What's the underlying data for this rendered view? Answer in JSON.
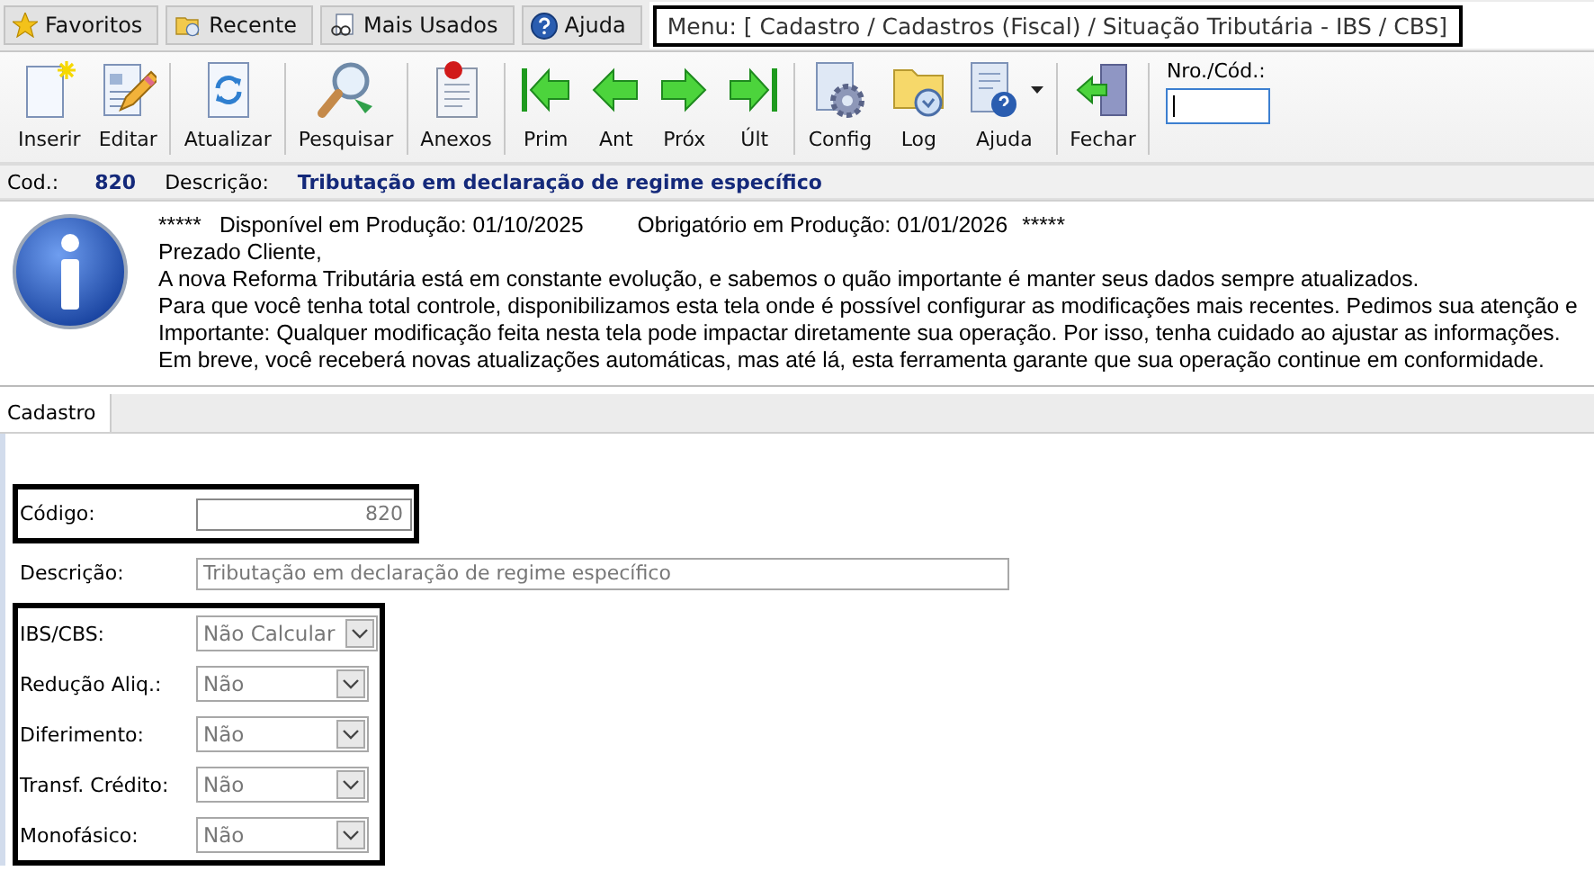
{
  "top_tabs": [
    {
      "label": "Favoritos",
      "kind": "favorites"
    },
    {
      "label": "Recente",
      "kind": "recent"
    },
    {
      "label": "Mais Usados",
      "kind": "most_used"
    },
    {
      "label": "Ajuda",
      "kind": "help"
    }
  ],
  "menu": {
    "path": "Menu: [ Cadastro / Cadastros (Fiscal) / Situação Tributária - IBS / CBS]",
    "highlighted": true
  },
  "toolbar": [
    [
      {
        "label": "Inserir",
        "kind": "new",
        "dropdown": false
      },
      {
        "label": "Editar",
        "kind": "edit",
        "dropdown": false
      }
    ],
    [
      {
        "label": "Atualizar",
        "kind": "refresh",
        "dropdown": false
      }
    ],
    [
      {
        "label": "Pesquisar",
        "kind": "search",
        "dropdown": false
      }
    ],
    [
      {
        "label": "Anexos",
        "kind": "attach",
        "dropdown": false
      }
    ],
    [
      {
        "label": "Prim",
        "kind": "first",
        "dropdown": false
      },
      {
        "label": "Ant",
        "kind": "prev",
        "dropdown": false
      },
      {
        "label": "Próx",
        "kind": "next",
        "dropdown": false
      },
      {
        "label": "Últ",
        "kind": "last",
        "dropdown": false
      }
    ],
    [
      {
        "label": "Config",
        "kind": "config",
        "dropdown": false
      },
      {
        "label": "Log",
        "kind": "log",
        "dropdown": false
      },
      {
        "label": "Ajuda",
        "kind": "helpdoc",
        "dropdown": true
      }
    ],
    [
      {
        "label": "Fechar",
        "kind": "exit",
        "dropdown": false
      }
    ]
  ],
  "lookup": {
    "label": "Nro./Cód.:",
    "focused": true
  },
  "record_bar": {
    "code_label": "Cod.:",
    "code": "820",
    "description_label": "Descrição:",
    "description": "Tributação em declaração de regime específico"
  },
  "notice": {
    "header": [
      "*****",
      "Disponível em Produção: 01/10/2025",
      "Obrigatório em Produção: 01/01/2026",
      "*****"
    ],
    "lines": [
      "Prezado Cliente,",
      "A nova Reforma Tributária está em constante evolução, e sabemos o quão importante é manter seus dados sempre atualizados.",
      "Para que você tenha total controle, disponibilizamos esta tela onde é possível configurar as modificações mais recentes. Pedimos sua atenção e",
      "Importante: Qualquer modificação feita nesta tela pode impactar diretamente sua operação. Por isso, tenha cuidado ao ajustar as informações.",
      "Em breve, você receberá novas atualizações automáticas, mas até lá, esta ferramenta garante que sua operação continue em conformidade."
    ]
  },
  "tabs": [
    {
      "label": "Cadastro",
      "selected": true
    }
  ],
  "form_groups": [
    {
      "highlighted": true,
      "fields": [
        {
          "label": "Código:",
          "kind": "number",
          "value": "820"
        }
      ]
    },
    {
      "highlighted": false,
      "fields": [
        {
          "label": "Descrição:",
          "kind": "text",
          "value": "Tributação em declaração de regime específico"
        }
      ]
    },
    {
      "highlighted": true,
      "fields": [
        {
          "label": "IBS/CBS:",
          "kind": "select",
          "value": "Não Calcular"
        },
        {
          "label": "Redução Aliq.:",
          "kind": "select",
          "value": "Não"
        },
        {
          "label": "Diferimento:",
          "kind": "select",
          "value": "Não"
        },
        {
          "label": "Transf. Crédito:",
          "kind": "select",
          "value": "Não"
        },
        {
          "label": "Monofásico:",
          "kind": "select",
          "value": "Não"
        }
      ]
    }
  ]
}
